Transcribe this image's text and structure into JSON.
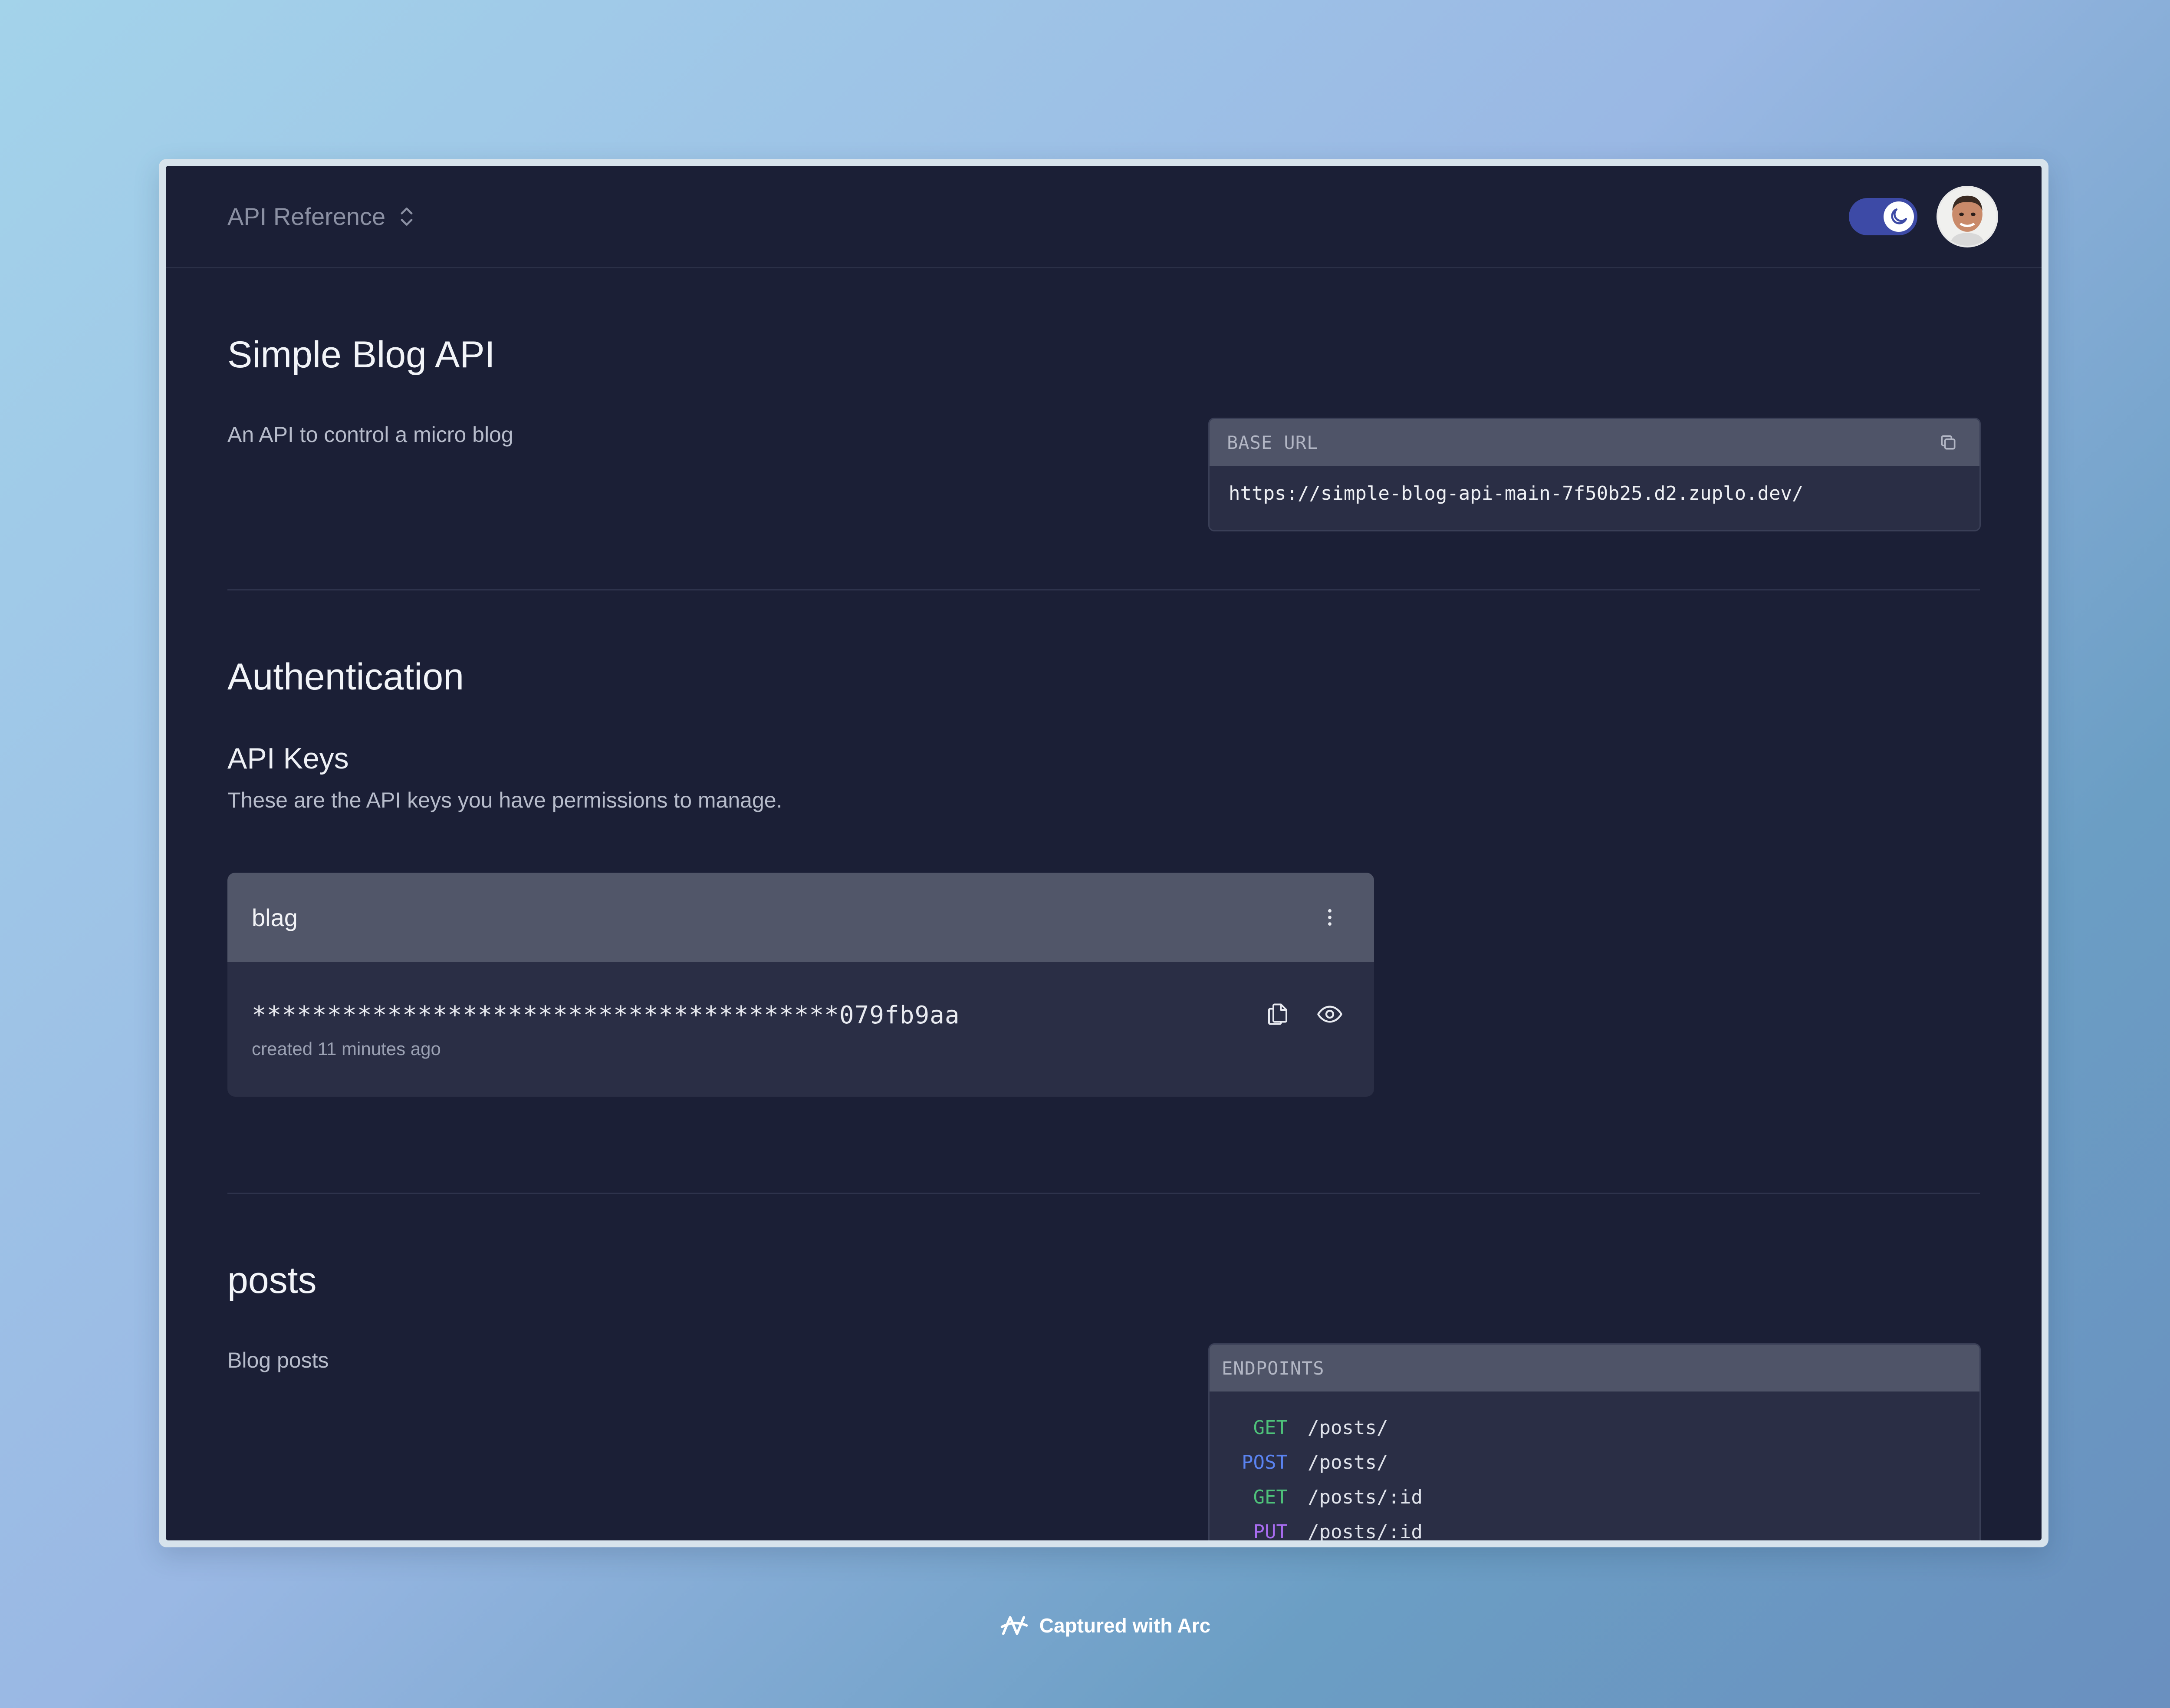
{
  "header": {
    "api_selector_label": "API Reference"
  },
  "intro": {
    "title": "Simple Blog API",
    "description": "An API to control a micro blog",
    "base_url_label": "BASE URL",
    "base_url": "https://simple-blog-api-main-7f50b25.d2.zuplo.dev/"
  },
  "auth": {
    "title": "Authentication",
    "subtitle": "API Keys",
    "description": "These are the API keys you have permissions to manage.",
    "key": {
      "name": "blag",
      "masked_value": "***************************************079fb9aa",
      "created": "created 11 minutes ago"
    }
  },
  "posts": {
    "title": "posts",
    "description": "Blog posts",
    "endpoints_label": "ENDPOINTS",
    "endpoints": [
      {
        "method": "GET",
        "path": "/posts/",
        "color": "#4ec27a"
      },
      {
        "method": "POST",
        "path": "/posts/",
        "color": "#5a83f0"
      },
      {
        "method": "GET",
        "path": "/posts/:id",
        "color": "#4ec27a"
      },
      {
        "method": "PUT",
        "path": "/posts/:id",
        "color": "#a86cf0"
      }
    ]
  },
  "footer": {
    "label": "Captured with Arc"
  },
  "colors": {
    "page_bg": "#1b1f36",
    "toggle": "#3d4aa6"
  }
}
